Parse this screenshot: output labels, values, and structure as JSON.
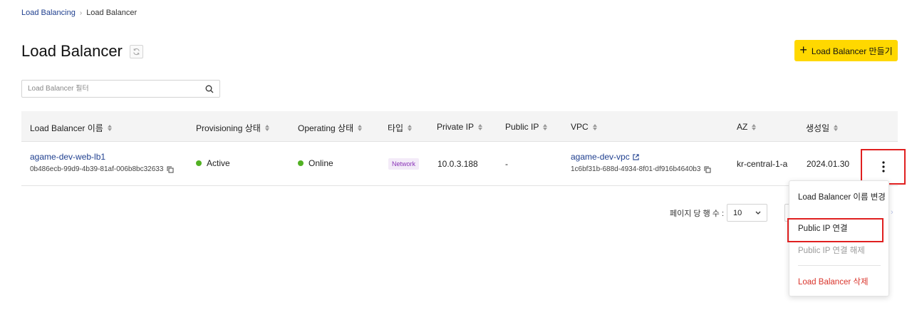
{
  "breadcrumb": {
    "parent": "Load Balancing",
    "separator": "›",
    "current": "Load Balancer"
  },
  "page": {
    "title": "Load Balancer"
  },
  "toolbar": {
    "create_label": "Load Balancer 만들기"
  },
  "search": {
    "placeholder": "Load Balancer 필터"
  },
  "table": {
    "columns": [
      "Load Balancer 이름",
      "Provisioning 상태",
      "Operating 상태",
      "타입",
      "Private IP",
      "Public IP",
      "VPC",
      "AZ",
      "생성일"
    ],
    "rows": [
      {
        "name": "agame-dev-web-lb1",
        "id": "0b486ecb-99d9-4b39-81af-006b8bc32633",
        "provisioning": "Active",
        "operating": "Online",
        "type": "Network",
        "private_ip": "10.0.3.188",
        "public_ip": "-",
        "vpc_name": "agame-dev-vpc",
        "vpc_id": "1c6bf31b-688d-4934-8f01-df916b4640b3",
        "az": "kr-central-1-a",
        "created": "2024.01.30"
      }
    ]
  },
  "pagination": {
    "rows_label": "페이지 당 행 수 :",
    "rows_per_page": "10"
  },
  "context_menu": {
    "items": [
      {
        "label": "Load Balancer 이름 변경",
        "state": "normal"
      },
      {
        "label": "Public IP 연결",
        "state": "normal"
      },
      {
        "label": "Public IP 연결 해제",
        "state": "disabled"
      },
      {
        "label": "Load Balancer 삭제",
        "state": "danger"
      }
    ]
  },
  "colors": {
    "accent_yellow": "#ffd800",
    "link_blue": "#1f3f8f",
    "status_green": "#52b123",
    "danger_red": "#d9342b",
    "highlight_red": "#e02020",
    "badge_purple": "#8a34b8"
  }
}
